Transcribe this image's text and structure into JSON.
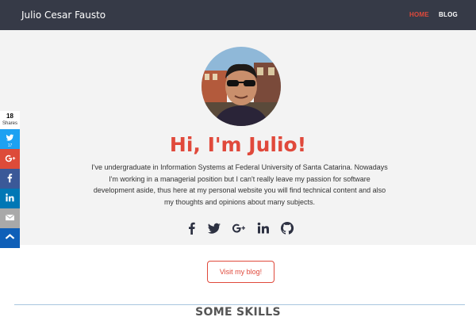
{
  "navbar": {
    "brand": "Julio Cesar Fausto",
    "links": [
      {
        "label": "HOME",
        "active": true
      },
      {
        "label": "BLOG",
        "active": false
      }
    ]
  },
  "hero": {
    "headline": "Hi, I'm Julio!",
    "intro": "I've undergraduate in Information Systems at Federal University of Santa Catarina. Nowadays I'm working in a managerial position but I can't really leave my passion for software development aside, thus here at my personal website you will find technical content and also my thoughts and opinions about many subjects.",
    "social": [
      "facebook-icon",
      "twitter-icon",
      "google-plus-icon",
      "linkedin-icon",
      "github-icon"
    ]
  },
  "blog_button": "Visit my blog!",
  "skills": {
    "title": "SOME SKILLS"
  },
  "share_bar": {
    "count": "18",
    "count_label": "Shares",
    "buttons": [
      {
        "icon": "twitter-icon",
        "count": "17",
        "color": "#1da1f2"
      },
      {
        "icon": "google-plus-icon",
        "color": "#dd4b39"
      },
      {
        "icon": "facebook-icon",
        "color": "#3b5998"
      },
      {
        "icon": "linkedin-icon",
        "color": "#0077b5"
      },
      {
        "icon": "email-icon",
        "color": "#a9a9a9"
      },
      {
        "icon": "sumo-share-icon",
        "color": "#0f5fb8"
      }
    ]
  },
  "colors": {
    "navbar_bg": "#363a47",
    "accent": "#e0493b",
    "hero_bg": "#f3f3f3"
  }
}
